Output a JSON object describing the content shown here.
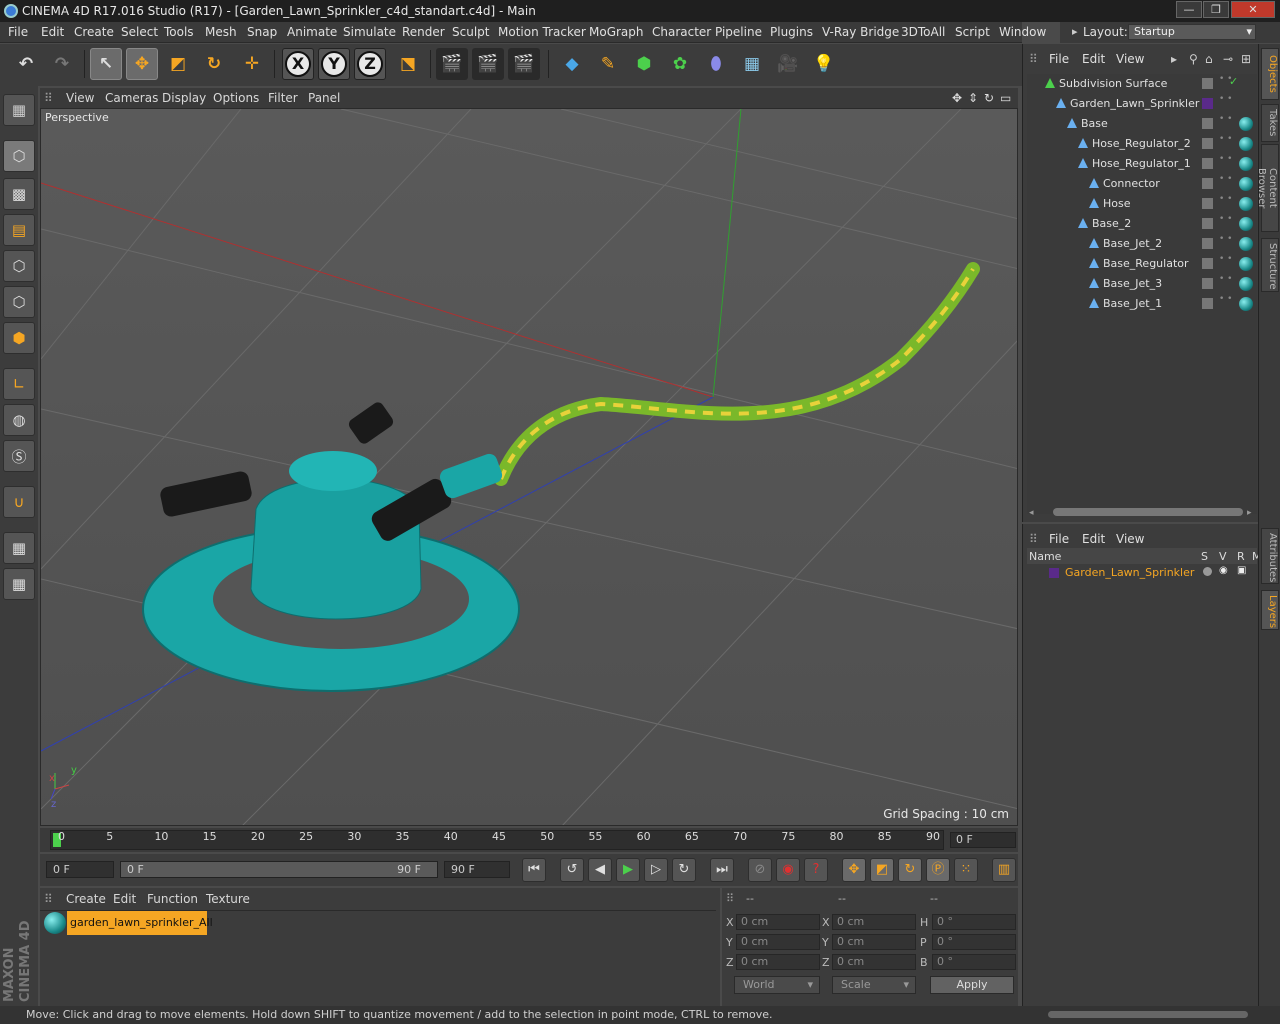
{
  "window": {
    "title": "CINEMA 4D R17.016 Studio (R17) - [Garden_Lawn_Sprinkler_c4d_standart.c4d] - Main",
    "min": "—",
    "max": "❐",
    "close": "✕"
  },
  "menu": [
    "File",
    "Edit",
    "Create",
    "Select",
    "Tools",
    "Mesh",
    "Snap",
    "Animate",
    "Simulate",
    "Render",
    "Sculpt",
    "Motion Tracker",
    "MoGraph",
    "Character",
    "Pipeline",
    "Plugins",
    "V-Ray Bridge",
    "3DToAll",
    "Script",
    "Window"
  ],
  "layout": {
    "label": "Layout:",
    "value": "Startup"
  },
  "toolbar": {
    "x": "X",
    "y": "Y",
    "z": "Z"
  },
  "viewport": {
    "menu": [
      "View",
      "Cameras",
      "Display",
      "Options",
      "Filter",
      "Panel"
    ],
    "label": "Perspective",
    "grid_spacing": "Grid Spacing : 10 cm",
    "axis": {
      "x": "x",
      "y": "y",
      "z": "z"
    }
  },
  "timeline": {
    "ticks": [
      "0",
      "5",
      "10",
      "15",
      "20",
      "25",
      "30",
      "35",
      "40",
      "45",
      "50",
      "55",
      "60",
      "65",
      "70",
      "75",
      "80",
      "85",
      "90"
    ],
    "frame": "0 F"
  },
  "playbar": {
    "start": "0 F",
    "range_start": "0 F",
    "range_end": "90 F",
    "end": "90 F"
  },
  "material_manager": {
    "menu": [
      "Create",
      "Edit",
      "Function",
      "Texture"
    ],
    "material": "garden_lawn_sprinkler_All"
  },
  "coordinates": {
    "headers": [
      "--",
      "--",
      "--"
    ],
    "rows": [
      {
        "a": "X",
        "av": "0 cm",
        "b": "X",
        "bv": "0 cm",
        "c": "H",
        "cv": "0 °"
      },
      {
        "a": "Y",
        "av": "0 cm",
        "b": "Y",
        "bv": "0 cm",
        "c": "P",
        "cv": "0 °"
      },
      {
        "a": "Z",
        "av": "0 cm",
        "b": "Z",
        "bv": "0 cm",
        "c": "B",
        "cv": "0 °"
      }
    ],
    "world": "World",
    "scale": "Scale",
    "apply": "Apply"
  },
  "status": "Move: Click and drag to move elements. Hold down SHIFT to quantize movement / add to the selection in point mode, CTRL to remove.",
  "brand": "MAXON CINEMA 4D",
  "object_manager": {
    "menu": [
      "File",
      "Edit",
      "View"
    ],
    "objects": [
      {
        "name": "Subdivision Surface",
        "indent": 0,
        "tag": false
      },
      {
        "name": "Garden_Lawn_Sprinkler",
        "indent": 1,
        "tag": false
      },
      {
        "name": "Base",
        "indent": 2,
        "tag": true
      },
      {
        "name": "Hose_Regulator_2",
        "indent": 3,
        "tag": true
      },
      {
        "name": "Hose_Regulator_1",
        "indent": 3,
        "tag": true
      },
      {
        "name": "Connector",
        "indent": 4,
        "tag": true
      },
      {
        "name": "Hose",
        "indent": 4,
        "tag": true
      },
      {
        "name": "Base_2",
        "indent": 3,
        "tag": true
      },
      {
        "name": "Base_Jet_2",
        "indent": 4,
        "tag": true
      },
      {
        "name": "Base_Regulator",
        "indent": 4,
        "tag": true
      },
      {
        "name": "Base_Jet_3",
        "indent": 4,
        "tag": true
      },
      {
        "name": "Base_Jet_1",
        "indent": 4,
        "tag": true
      }
    ]
  },
  "layer_manager": {
    "menu": [
      "File",
      "Edit",
      "View"
    ],
    "columns": {
      "name": "Name",
      "s": "S",
      "v": "V",
      "r": "R",
      "m": "M"
    },
    "layer": "Garden_Lawn_Sprinkler"
  },
  "side_tabs": [
    "Objects",
    "Takes",
    "Content Browser",
    "Structure",
    "Attributes",
    "Layers"
  ],
  "colors": {
    "accent": "#f5a623",
    "teal": "#1aa6a6",
    "hose_green": "#7ab82a",
    "hose_yellow": "#e8d23a"
  }
}
